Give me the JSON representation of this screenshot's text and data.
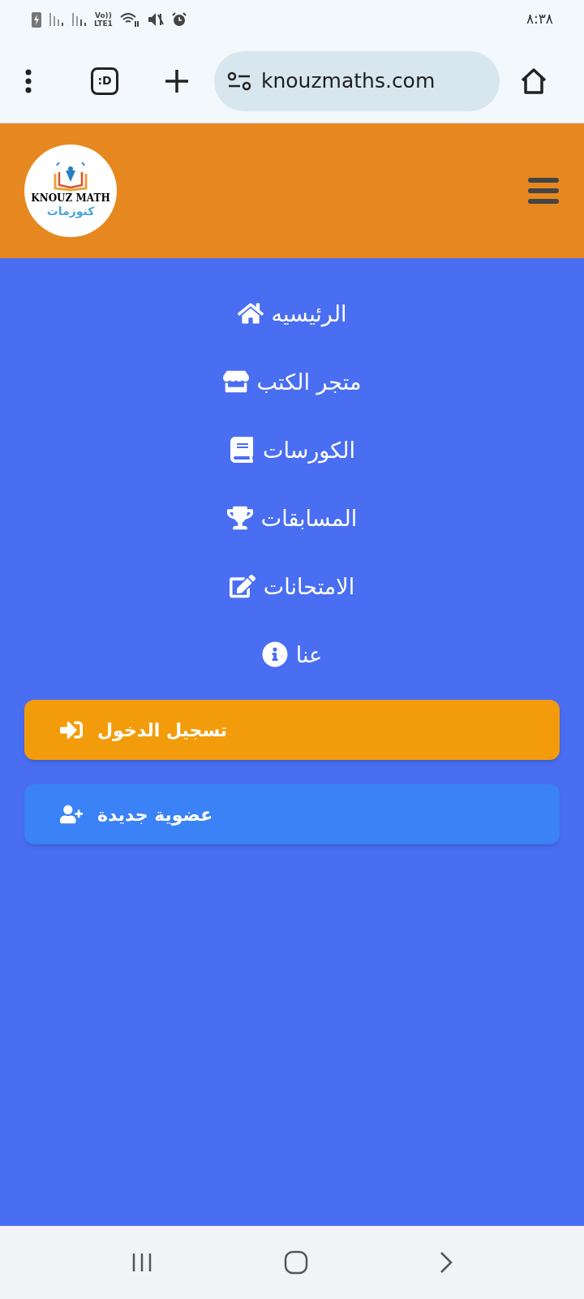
{
  "status_bar": {
    "network": [
      "Vo))",
      "LTE1"
    ],
    "time": "٨:٣٨"
  },
  "browser": {
    "tab_count": ":D",
    "url": "knouzmaths.com"
  },
  "header": {
    "logo": {
      "latin": "KNOUZ MATH",
      "arabic": "كنوزمات"
    }
  },
  "menu": [
    {
      "label": "الرئيسيه"
    },
    {
      "label": "متجر الكتب"
    },
    {
      "label": "الكورسات"
    },
    {
      "label": "المسابقات"
    },
    {
      "label": "الامتحانات"
    },
    {
      "label": "عنا"
    }
  ],
  "actions": [
    {
      "label": "تسجيل الدخول",
      "color": "#f39c0b"
    },
    {
      "label": "عضوية جديدة",
      "color": "#3b82f6"
    }
  ]
}
